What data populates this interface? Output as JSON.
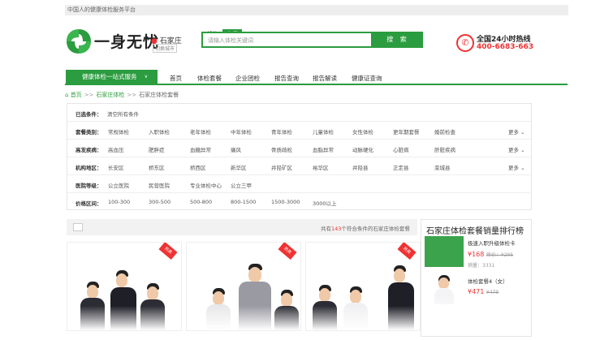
{
  "topbar": {
    "text": "中国人的健康体检服务平台"
  },
  "logo": {
    "text": "一身无忧"
  },
  "city": {
    "name": "石家庄",
    "switch": "切换城市"
  },
  "search": {
    "tabs": [
      "机构",
      "套餐"
    ],
    "placeholder": "请输入体检关键词",
    "button": "搜 索"
  },
  "hotline": {
    "title": "全国24小时热线",
    "number": "400-6683-663"
  },
  "nav": {
    "main": "健康体检一站式服务",
    "items": [
      "首页",
      "体检套餐",
      "企业团检",
      "报告查询",
      "报告解读",
      "健康证查询"
    ]
  },
  "breadcrumb": {
    "home": "首页",
    "city": "石家庄体检",
    "current": "石家庄体检套餐",
    "sep": ">>"
  },
  "filters": {
    "selected_label": "已选条件：",
    "selected_value": "清空所有条件",
    "rows": [
      {
        "label": "套餐类别：",
        "options": [
          "常规体检",
          "入职体检",
          "老年体检",
          "中年体检",
          "青年体检",
          "儿童体检",
          "女性体检",
          "更年期套餐",
          "婚前检查"
        ],
        "more": "更多"
      },
      {
        "label": "高发疾病：",
        "options": [
          "高血压",
          "肥胖症",
          "血糖异常",
          "痛风",
          "骨质疏松",
          "血脂异常",
          "动脉硬化",
          "心脏病",
          "肝脏疾病"
        ],
        "more": "更多"
      },
      {
        "label": "机构地区：",
        "options": [
          "长安区",
          "桥东区",
          "桥西区",
          "新华区",
          "井陉矿区",
          "裕华区",
          "井陉县",
          "正定县",
          "栾城县"
        ],
        "more": "更多"
      },
      {
        "label": "医院等级：",
        "options": [
          "公立医院",
          "民营医院",
          "专业体检中心",
          "公立三甲"
        ],
        "more": ""
      },
      {
        "label": "价格区间：",
        "options": [
          "100-300",
          "300-500",
          "500-800",
          "800-1500",
          "1500-3000",
          "3000以上"
        ],
        "more": ""
      }
    ]
  },
  "results": {
    "prefix": "共有",
    "count": "143",
    "suffix": "个符合条件的石家庄体检套餐"
  },
  "cards": [
    {
      "ribbon": "热卖"
    },
    {
      "ribbon": "热卖"
    },
    {
      "ribbon": "热卖"
    }
  ],
  "ranking": {
    "title": "石家庄体检套餐销量排行榜",
    "items": [
      {
        "name": "极速入职升级体检卡",
        "price": "¥168",
        "orig_label": "原价：",
        "orig": "¥295",
        "sales": "销量：3331"
      },
      {
        "name": "体检套餐4（女）",
        "price": "¥471",
        "orig": "¥479"
      }
    ]
  }
}
